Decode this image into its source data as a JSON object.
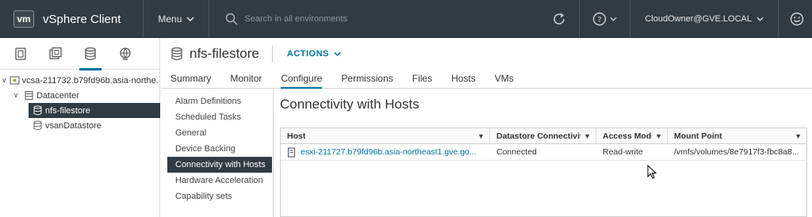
{
  "header": {
    "logo": "vm",
    "title": "vSphere Client",
    "menu_label": "Menu",
    "search_placeholder": "Search in all environments",
    "user": "CloudOwner@GVE.LOCAL"
  },
  "navigator": {
    "tabs": [
      "hosts-and-clusters-icon",
      "vms-and-templates-icon",
      "storage-icon",
      "networking-icon"
    ],
    "active_tab": 2,
    "tree": [
      {
        "label": "vcsa-211732.b79fd96b.asia-northe...",
        "icon": "vcenter-icon",
        "level": 0
      },
      {
        "label": "Datacenter",
        "icon": "datacenter-icon",
        "level": 1
      },
      {
        "label": "nfs-filestore",
        "icon": "datastore-icon",
        "level": 2,
        "selected": true
      },
      {
        "label": "vsanDatastore",
        "icon": "datastore-icon",
        "level": 2
      }
    ]
  },
  "object": {
    "name": "nfs-filestore",
    "actions_label": "ACTIONS",
    "tabs": [
      "Summary",
      "Monitor",
      "Configure",
      "Permissions",
      "Files",
      "Hosts",
      "VMs"
    ],
    "active_tab": "Configure"
  },
  "configure_menu": {
    "items": [
      "Alarm Definitions",
      "Scheduled Tasks",
      "General",
      "Device Backing",
      "Connectivity with Hosts",
      "Hardware Acceleration",
      "Capability sets"
    ],
    "active": "Connectivity with Hosts"
  },
  "content": {
    "title": "Connectivity with Hosts",
    "columns": [
      "Host",
      "Datastore Connectivity",
      "Access Mode",
      "Mount Point"
    ],
    "rows": [
      {
        "host": "esxi-211727.b79fd96b.asia-northeast1.gve.go...",
        "connectivity": "Connected",
        "access": "Read-write",
        "mount": "/vmfs/volumes/8e7917f3-fbc8a8..."
      }
    ]
  },
  "colors": {
    "header_bg": "#313b44",
    "accent": "#0072a3",
    "selected_bg": "#313b44"
  }
}
